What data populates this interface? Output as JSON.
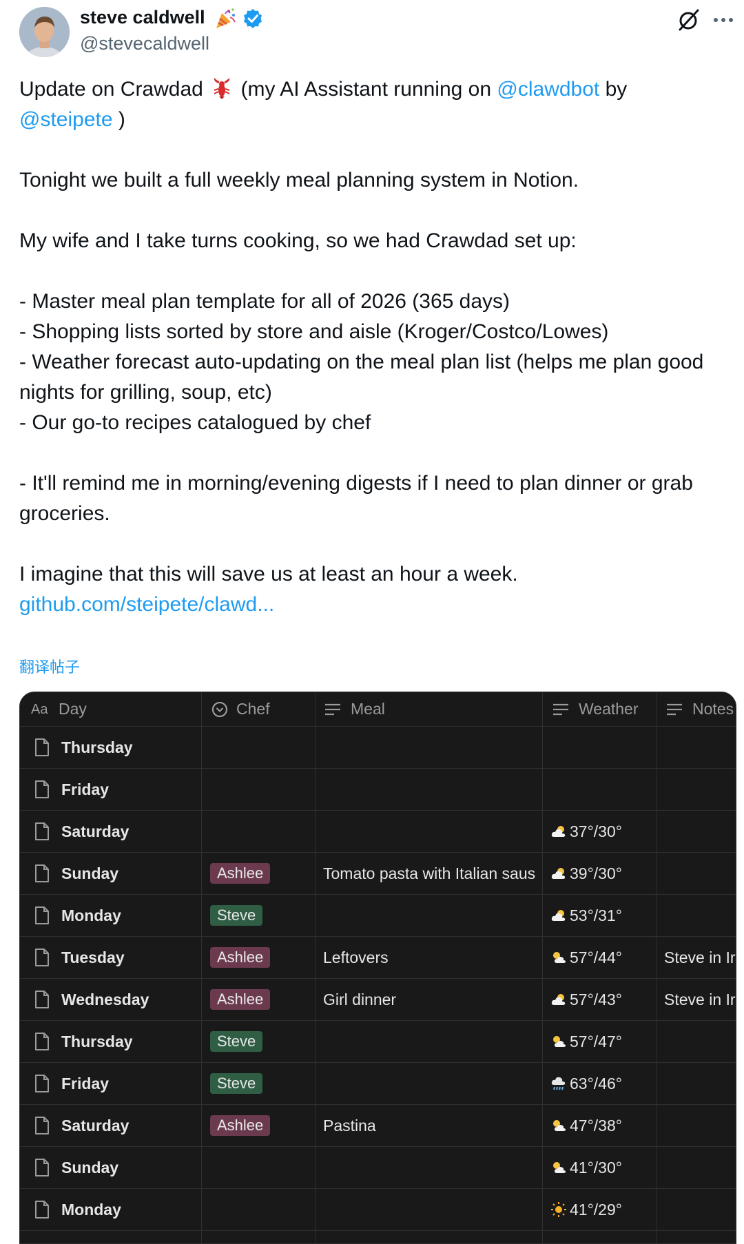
{
  "author": {
    "name": "steve caldwell",
    "handle": "@stevecaldwell",
    "badge_icon": "party-popper-icon",
    "verified_icon": "verified-badge-icon"
  },
  "header_actions": {
    "grok_icon": "grok-icon",
    "more_icon": "more-icon"
  },
  "tweet": {
    "line1_pre": "Update on Crawdad",
    "line1_mid": "(my AI Assistant running on",
    "mention1": "@clawdbot",
    "line1_by": "by",
    "mention2": "@steipete",
    "line1_end": ")",
    "p2": "Tonight we built a full weekly meal planning system in Notion.",
    "p3": "My wife and I take turns cooking, so we had Crawdad set up:",
    "b1": "- Master meal plan template for all of 2026 (365 days)",
    "b2": "- Shopping lists sorted by store and aisle (Kroger/Costco/Lowes)",
    "b3": "-  Weather forecast auto-updating on the meal plan list (helps me plan good nights for grilling, soup, etc)",
    "b4": "- Our go-to recipes catalogued by chef",
    "p5": "- It'll remind me in morning/evening digests if I need to plan dinner or grab groceries.",
    "p6": "I imagine that this will save us at least an hour a week.",
    "link": "github.com/steipete/clawd...",
    "translate": "翻译帖子"
  },
  "table": {
    "headers": {
      "day": "Day",
      "chef": "Chef",
      "meal": "Meal",
      "weather": "Weather",
      "notes": "Notes"
    },
    "chef_colors": {
      "Ashlee": "#6b3a4f",
      "Steve": "#2f5e44"
    },
    "rows": [
      {
        "day": "Thursday",
        "chef": "",
        "meal": "",
        "weather": "",
        "weather_icon": "",
        "notes": ""
      },
      {
        "day": "Friday",
        "chef": "",
        "meal": "",
        "weather": "",
        "weather_icon": "",
        "notes": ""
      },
      {
        "day": "Saturday",
        "chef": "",
        "meal": "",
        "weather": "37°/30°",
        "weather_icon": "cloudy-icon",
        "notes": ""
      },
      {
        "day": "Sunday",
        "chef": "Ashlee",
        "meal": "Tomato pasta with Italian saus",
        "weather": "39°/30°",
        "weather_icon": "cloudy-icon",
        "notes": ""
      },
      {
        "day": "Monday",
        "chef": "Steve",
        "meal": "",
        "weather": "53°/31°",
        "weather_icon": "cloudy-icon",
        "notes": ""
      },
      {
        "day": "Tuesday",
        "chef": "Ashlee",
        "meal": "Leftovers",
        "weather": "57°/44°",
        "weather_icon": "partly-sunny-icon",
        "notes": "Steve in Ir"
      },
      {
        "day": "Wednesday",
        "chef": "Ashlee",
        "meal": "Girl dinner",
        "weather": "57°/43°",
        "weather_icon": "cloudy-icon",
        "notes": "Steve in Ir"
      },
      {
        "day": "Thursday",
        "chef": "Steve",
        "meal": "",
        "weather": "57°/47°",
        "weather_icon": "partly-sunny-icon",
        "notes": ""
      },
      {
        "day": "Friday",
        "chef": "Steve",
        "meal": "",
        "weather": "63°/46°",
        "weather_icon": "rain-icon",
        "notes": ""
      },
      {
        "day": "Saturday",
        "chef": "Ashlee",
        "meal": "Pastina",
        "weather": "47°/38°",
        "weather_icon": "partly-sunny-icon",
        "notes": ""
      },
      {
        "day": "Sunday",
        "chef": "",
        "meal": "",
        "weather": "41°/30°",
        "weather_icon": "partly-sunny-icon",
        "notes": ""
      },
      {
        "day": "Monday",
        "chef": "",
        "meal": "",
        "weather": "41°/29°",
        "weather_icon": "sun-icon",
        "notes": ""
      }
    ]
  }
}
